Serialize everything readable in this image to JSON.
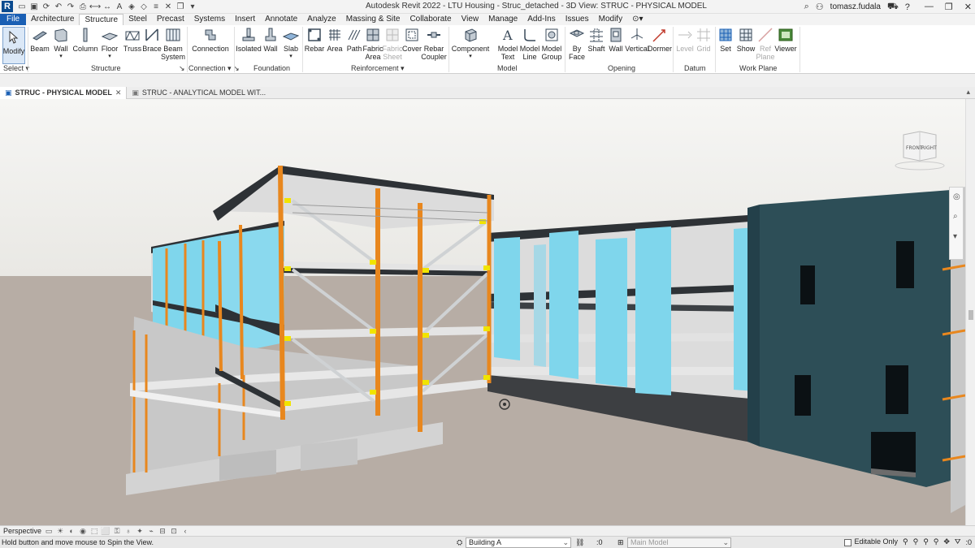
{
  "window": {
    "title": "Autodesk Revit 2022 - LTU Housing - Struc_detached - 3D View: STRUC - PHYSICAL MODEL",
    "user": "tomasz.fudala"
  },
  "tabs": [
    "File",
    "Architecture",
    "Structure",
    "Steel",
    "Precast",
    "Systems",
    "Insert",
    "Annotate",
    "Analyze",
    "Massing & Site",
    "Collaborate",
    "View",
    "Manage",
    "Add-Ins",
    "Issues",
    "Modify"
  ],
  "ribbon": {
    "modify": "Modify",
    "select": "Select",
    "structure_items": [
      "Beam",
      "Wall",
      "Column",
      "Floor",
      "Truss",
      "Brace",
      "Beam"
    ],
    "beam_system_line2": "System",
    "connection": "Connection",
    "foundation_items": [
      "Isolated",
      "Wall",
      "Slab"
    ],
    "rebar": "Rebar",
    "area": "Area",
    "path": "Path",
    "fabric_area": [
      "Fabric",
      "Area"
    ],
    "fabric_sheet": [
      "Fabric",
      "Sheet"
    ],
    "cover": "Cover",
    "rebar_coupler": [
      "Rebar",
      "Coupler"
    ],
    "component": "Component",
    "model_text": [
      "Model",
      "Text"
    ],
    "model_line": [
      "Model",
      "Line"
    ],
    "model_group": [
      "Model",
      "Group"
    ],
    "by_face": [
      "By",
      "Face"
    ],
    "shaft": "Shaft",
    "opening_wall": "Wall",
    "vertical": "Vertical",
    "dormer": "Dormer",
    "level": "Level",
    "grid": "Grid",
    "set": "Set",
    "show": "Show",
    "ref_plane": [
      "Ref",
      "Plane"
    ],
    "viewer": "Viewer",
    "panels": {
      "select": "Select",
      "structure": "Structure",
      "connection": "Connection",
      "foundation": "Foundation",
      "reinforcement": "Reinforcement",
      "model": "Model",
      "opening": "Opening",
      "datum": "Datum",
      "work_plane": "Work Plane"
    }
  },
  "view_tabs": [
    {
      "label": "STRUC - PHYSICAL MODEL",
      "active": true
    },
    {
      "label": "STRUC - ANALYTICAL MODEL WIT...",
      "active": false
    }
  ],
  "viewcube": {
    "front": "FRONT",
    "right": "RIGHT"
  },
  "viewbar": {
    "mode": "Perspective"
  },
  "status": {
    "message": "Hold button and move mouse to Spin the View.",
    "workset": "Building A",
    "workset_count": ":0",
    "design_option": "Main Model",
    "editable_only": "Editable Only",
    "filter_count": ":0"
  },
  "colors": {
    "accent": "#1a5fb4",
    "steel_column": "#e8871e",
    "wall_blue": "#7fd6ec",
    "facade": "#2d4e57",
    "slab": "#d9d9d9",
    "ground": "#b7ada5",
    "sky": "#f2f2f0"
  }
}
